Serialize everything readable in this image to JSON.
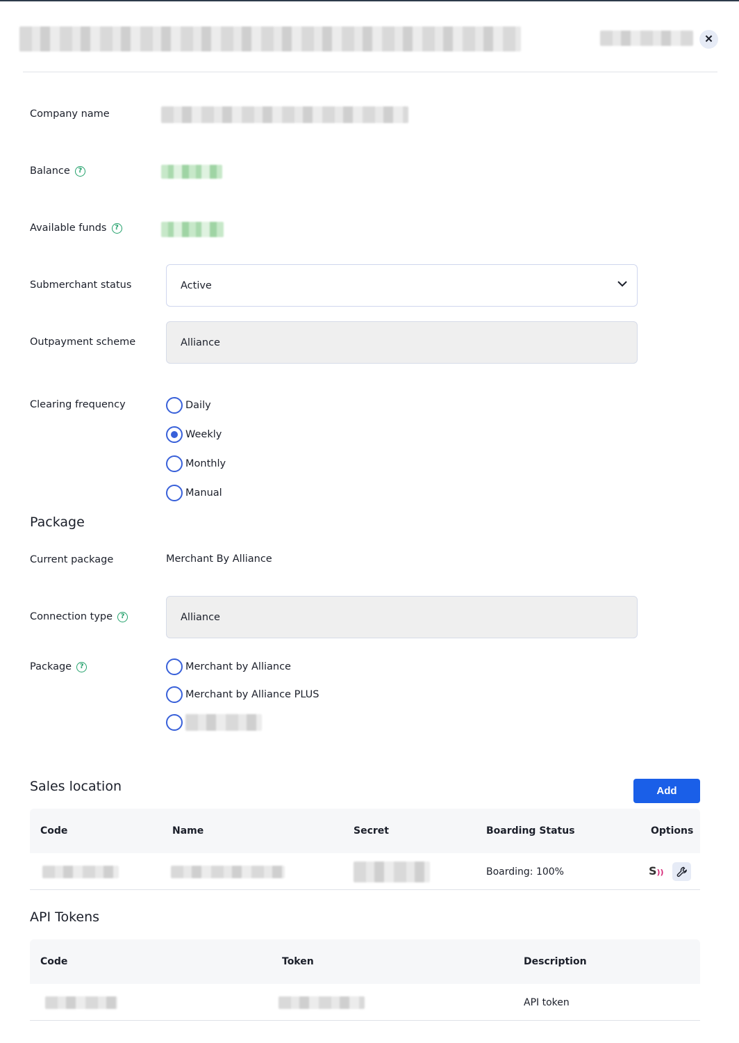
{
  "form": {
    "company_name_label": "Company name",
    "balance_label": "Balance",
    "available_funds_label": "Available funds",
    "submerchant_status_label": "Submerchant status",
    "submerchant_status_value": "Active",
    "outpayment_scheme_label": "Outpayment scheme",
    "outpayment_scheme_value": "Alliance",
    "clearing_frequency_label": "Clearing frequency",
    "clearing_options": [
      {
        "label": "Daily",
        "selected": false
      },
      {
        "label": "Weekly",
        "selected": true
      },
      {
        "label": "Monthly",
        "selected": false
      },
      {
        "label": "Manual",
        "selected": false
      }
    ]
  },
  "package_section": {
    "title": "Package",
    "current_package_label": "Current package",
    "current_package_value": "Merchant By Alliance",
    "connection_type_label": "Connection type",
    "connection_type_value": "Alliance",
    "package_label": "Package",
    "package_options": [
      {
        "label": "Merchant by Alliance",
        "selected": false
      },
      {
        "label": "Merchant by Alliance PLUS",
        "selected": false
      }
    ]
  },
  "sales_location": {
    "title": "Sales location",
    "add_label": "Add",
    "columns": [
      "Code",
      "Name",
      "Secret",
      "Boarding Status",
      "Options"
    ],
    "rows": [
      {
        "boarding_status": "Boarding: 100%"
      }
    ]
  },
  "api_tokens": {
    "title": "API Tokens",
    "columns": [
      "Code",
      "Token",
      "Description"
    ],
    "rows": [
      {
        "description": "API token"
      }
    ]
  },
  "icons": {
    "close": "close-icon",
    "help": "help-circle-icon",
    "chevron": "chevron-down-icon",
    "wrench": "wrench-icon",
    "logo": "sales-logo-icon"
  },
  "colors": {
    "accent": "#1a5fe8",
    "radio": "#3860d9",
    "help": "#21a06a"
  }
}
